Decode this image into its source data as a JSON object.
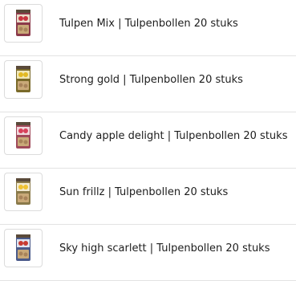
{
  "products": [
    {
      "title": "Tulpen Mix | Tulpenbollen 20 stuks",
      "thumb_icon": "tulip-bag-icon",
      "pack_color": "#8b3a4a",
      "flower_color": "#c8333f",
      "label_color": "#e8dcc8"
    },
    {
      "title": "Strong gold | Tulpenbollen 20 stuks",
      "thumb_icon": "tulip-bag-icon",
      "pack_color": "#7a6a2a",
      "flower_color": "#e2b923",
      "label_color": "#efe6b8"
    },
    {
      "title": "Candy apple delight | Tulpenbollen 20 stuks",
      "thumb_icon": "tulip-bag-icon",
      "pack_color": "#a04a5a",
      "flower_color": "#d8405a",
      "label_color": "#f0d8dc"
    },
    {
      "title": "Sun frillz | Tulpenbollen 20 stuks",
      "thumb_icon": "tulip-bag-icon",
      "pack_color": "#8a7a4a",
      "flower_color": "#f0c232",
      "label_color": "#f2ead0"
    },
    {
      "title": "Sky high scarlett | Tulpenbollen 20 stuks",
      "thumb_icon": "tulip-bag-icon",
      "pack_color": "#4a5a8a",
      "flower_color": "#c83a30",
      "label_color": "#dfe4f0"
    }
  ]
}
